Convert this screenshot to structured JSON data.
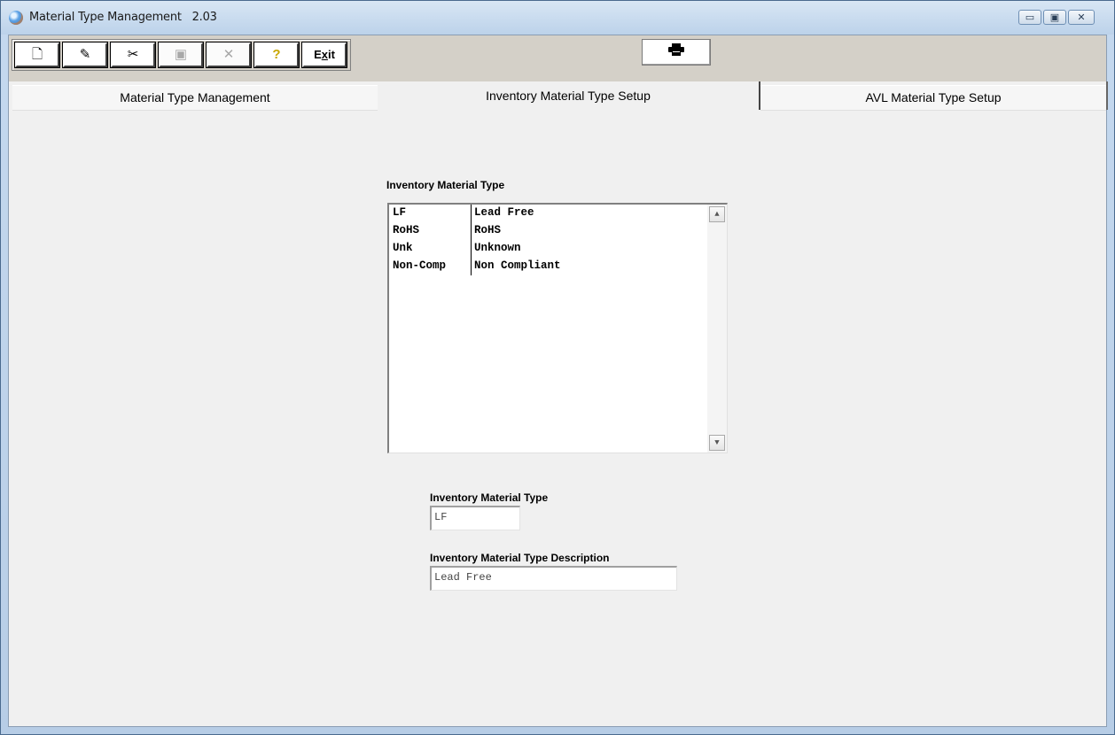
{
  "window": {
    "title": "Material Type Management   2.03",
    "controls": {
      "minimize": "▭",
      "maximize": "▣",
      "close": "✕"
    }
  },
  "toolbar": {
    "buttons": [
      {
        "name": "new",
        "icon": "new-document-icon",
        "glyph": "🗋",
        "enabled": true
      },
      {
        "name": "edit",
        "icon": "edit-icon",
        "glyph": "✎",
        "enabled": true
      },
      {
        "name": "cut",
        "icon": "scissors-icon",
        "glyph": "✂",
        "enabled": true
      },
      {
        "name": "save",
        "icon": "save-icon",
        "glyph": "▣",
        "enabled": false
      },
      {
        "name": "delete",
        "icon": "delete-x-icon",
        "glyph": "✕",
        "enabled": false
      },
      {
        "name": "help",
        "icon": "help-icon",
        "glyph": "?",
        "enabled": true
      }
    ],
    "exit_label_pre": "E",
    "exit_label_u": "x",
    "exit_label_post": "it",
    "print_icon": "printer-icon"
  },
  "tabs": [
    {
      "label": "Material Type Management"
    },
    {
      "label": "Inventory Material Type Setup"
    },
    {
      "label": "AVL Material Type Setup"
    }
  ],
  "active_tab": "Inventory Material Type Setup",
  "main": {
    "list_title": "Inventory Material Type",
    "list_rows": [
      {
        "code": "LF",
        "description": "Lead Free"
      },
      {
        "code": "RoHS",
        "description": "RoHS"
      },
      {
        "code": "Unk",
        "description": "Unknown"
      },
      {
        "code": "Non-Comp",
        "description": "Non Compliant"
      }
    ],
    "type_label": "Inventory Material Type",
    "type_value": "LF",
    "desc_label": "Inventory Material Type Description",
    "desc_value": "Lead Free"
  },
  "colors": {
    "toolbar_bg": "#d4d0c8",
    "content_bg": "#f0f0f0",
    "help_icon": "#e8c800"
  }
}
